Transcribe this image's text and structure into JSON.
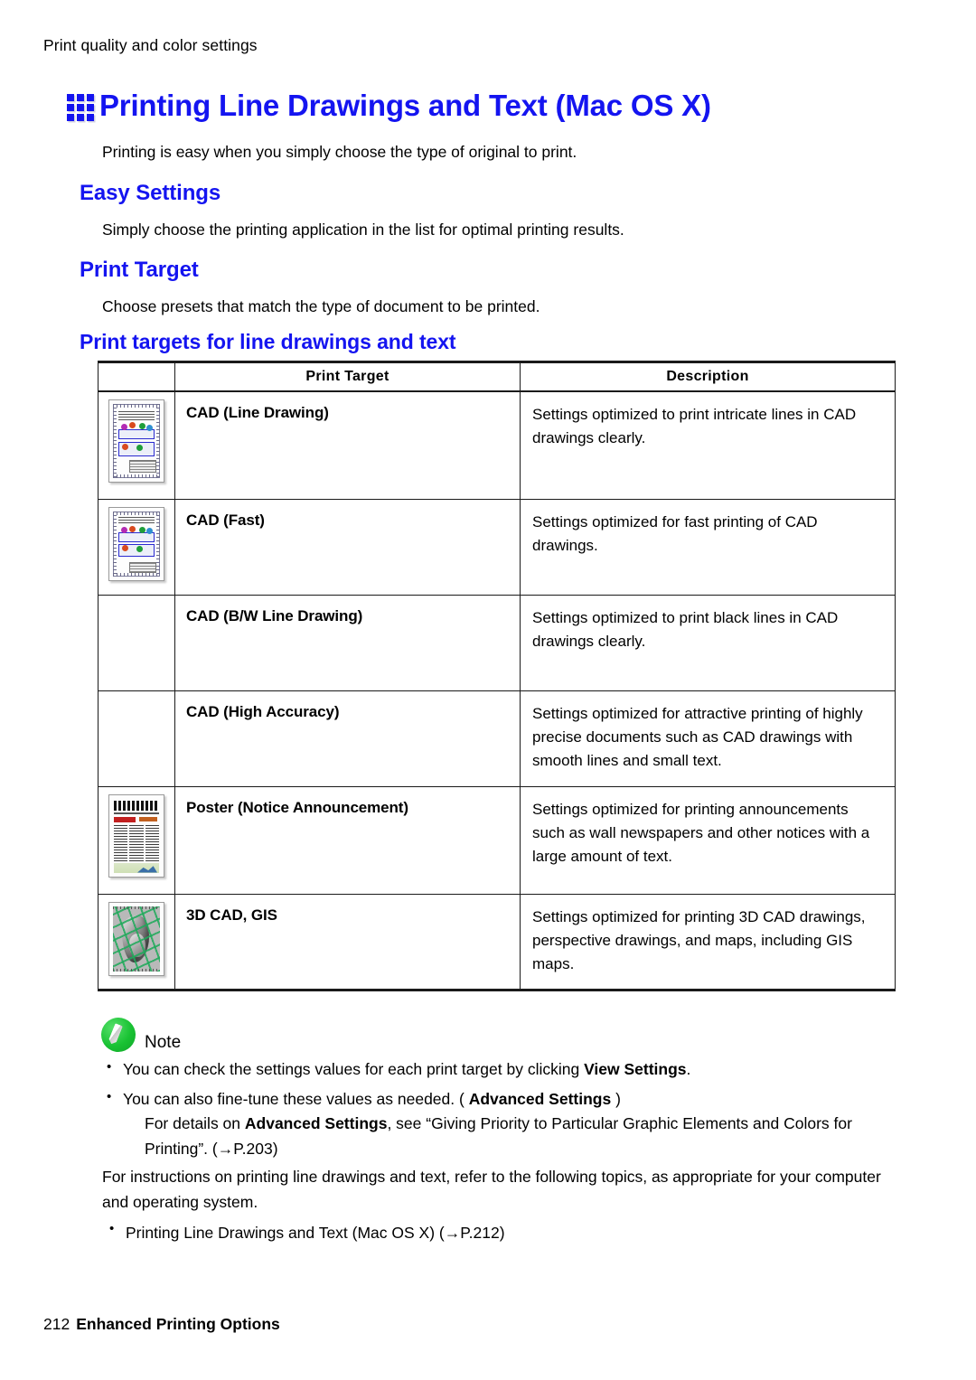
{
  "running_header": "Print quality and color settings",
  "chapter": {
    "icon": "grid-squares-icon",
    "title": "Printing Line Drawings and Text (Mac OS X)",
    "intro": "Printing is easy when you simply choose the type of original to print."
  },
  "sections": [
    {
      "heading": "Easy Settings",
      "text": "Simply choose the printing application in the list for optimal printing results."
    },
    {
      "heading": "Print Target",
      "text": "Choose presets that match the type of document to be printed."
    }
  ],
  "table": {
    "caption": "Print targets for line drawings and text",
    "headers": [
      "",
      "Print Target",
      "Description"
    ],
    "rows": [
      {
        "thumbnail": "cad-line-drawing-thumbnail",
        "name": "CAD (Line Drawing)",
        "description": "Settings optimized to print intricate lines in CAD drawings clearly."
      },
      {
        "thumbnail": "cad-fast-thumbnail",
        "name": "CAD (Fast)",
        "description": "Settings optimized for fast printing of CAD drawings."
      },
      {
        "thumbnail": "",
        "name": "CAD (B/W Line Drawing)",
        "description": "Settings optimized to print black lines in CAD drawings clearly."
      },
      {
        "thumbnail": "",
        "name": "CAD (High Accuracy)",
        "description": "Settings optimized for attractive printing of highly precise documents such as CAD drawings with smooth lines and small text."
      },
      {
        "thumbnail": "poster-newspaper-thumbnail",
        "name": "Poster (Notice Announcement)",
        "description": "Settings optimized for printing announcements such as wall newspapers and other notices with a large amount of text."
      },
      {
        "thumbnail": "3d-cad-gis-thumbnail",
        "name": "3D CAD, GIS",
        "description": "Settings optimized for printing 3D CAD drawings, perspective drawings, and maps, including GIS maps."
      }
    ]
  },
  "note": {
    "icon": "pencil-note-icon",
    "label": "Note",
    "items": [
      {
        "text_before": "You can check the settings values for each print target by clicking ",
        "bold": "View Settings",
        "text_after": "."
      },
      {
        "text_before": "You can also fine-tune these values as needed. ( ",
        "bold": "Advanced Settings",
        "text_after": " )"
      }
    ],
    "continuation": {
      "text_before": "For details on ",
      "bold": "Advanced Settings",
      "text_after": ", see “Giving Priority to Particular Graphic Elements and Colors for Printing”. (→P.203)"
    }
  },
  "closing": {
    "paragraph": "For instructions on printing line drawings and text, refer to the following topics, as appropriate for your computer and operating system.",
    "links": [
      "Printing Line Drawings and Text (Mac OS X) (→P.212)"
    ]
  },
  "footer": {
    "page_number": "212",
    "section_title": "Enhanced Printing Options"
  },
  "colors": {
    "heading_blue": "#1414f0",
    "note_green": "#19c233",
    "rule_black": "#1a1a1a"
  }
}
